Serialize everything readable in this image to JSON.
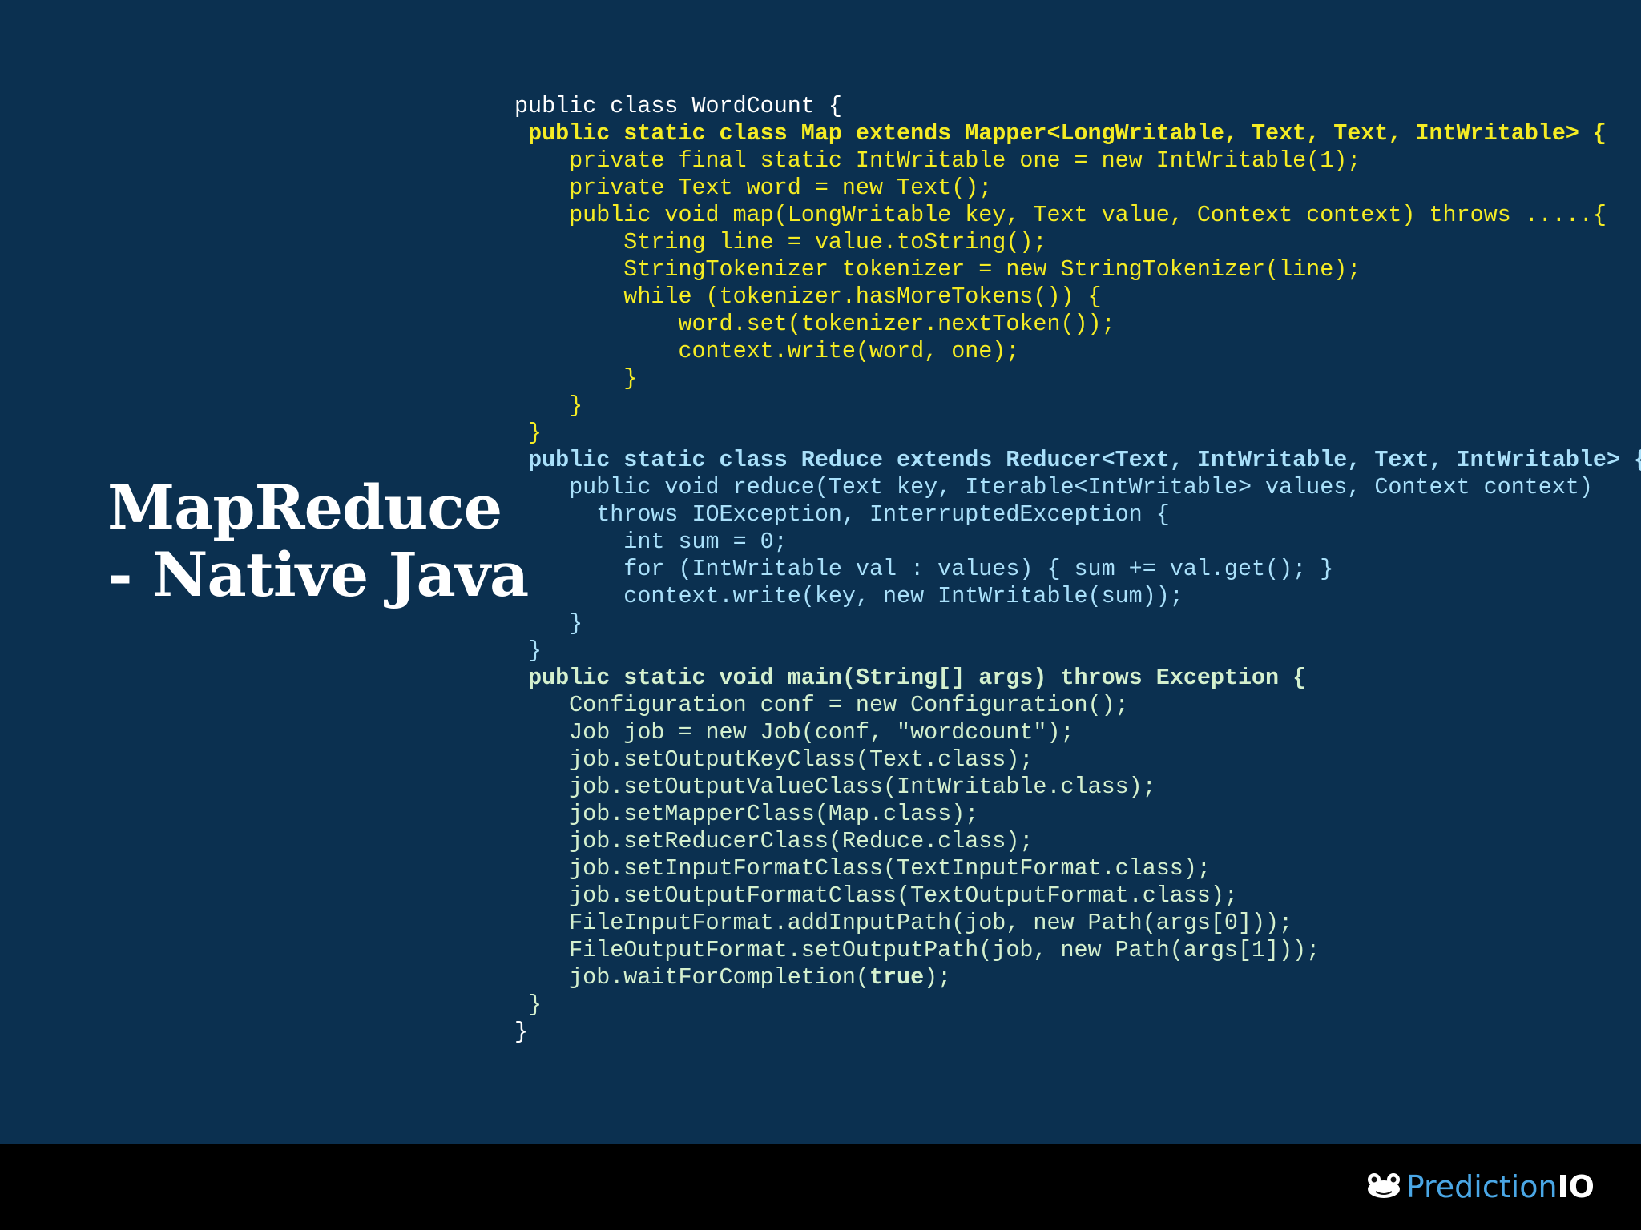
{
  "title": {
    "line1": "MapReduce",
    "line2": "- Native Java"
  },
  "code_lines": [
    "public class WordCount {",
    " public static class Map extends Mapper<LongWritable, Text, Text, IntWritable> {",
    "    private final static IntWritable one = new IntWritable(1);",
    "    private Text word = new Text();",
    "    public void map(LongWritable key, Text value, Context context) throws .....{",
    "        String line = value.toString();",
    "        StringTokenizer tokenizer = new StringTokenizer(line);",
    "        while (tokenizer.hasMoreTokens()) {",
    "            word.set(tokenizer.nextToken());",
    "            context.write(word, one);",
    "        }",
    "    }",
    " }",
    " public static class Reduce extends Reducer<Text, IntWritable, Text, IntWritable> {",
    "    public void reduce(Text key, Iterable<IntWritable> values, Context context)",
    "      throws IOException, InterruptedException {",
    "        int sum = 0;",
    "        for (IntWritable val : values) { sum += val.get(); }",
    "        context.write(key, new IntWritable(sum));",
    "    }",
    " }",
    " public static void main(String[] args) throws Exception {",
    "    Configuration conf = new Configuration();",
    "    Job job = new Job(conf, \"wordcount\");",
    "    job.setOutputKeyClass(Text.class);",
    "    job.setOutputValueClass(IntWritable.class);",
    "    job.setMapperClass(Map.class);",
    "    job.setReducerClass(Reduce.class);",
    "    job.setInputFormatClass(TextInputFormat.class);",
    "    job.setOutputFormatClass(TextOutputFormat.class);",
    "    FileInputFormat.addInputPath(job, new Path(args[0]));",
    "    FileOutputFormat.setOutputPath(job, new Path(args[1]));",
    "    job.waitForCompletion(",
    "true",
    ");",
    " }",
    "}"
  ],
  "colors": {
    "background": "#0b3050",
    "footer": "#000000",
    "class_header": "#ffffff",
    "mapper": "#f5ec24",
    "reducer": "#a9e0fa",
    "main": "#d4f0ce",
    "brand_blue": "#4aa7e6"
  },
  "brand": {
    "icon": "frog-icon",
    "name_part1": "Prediction",
    "name_part2": "IO"
  }
}
